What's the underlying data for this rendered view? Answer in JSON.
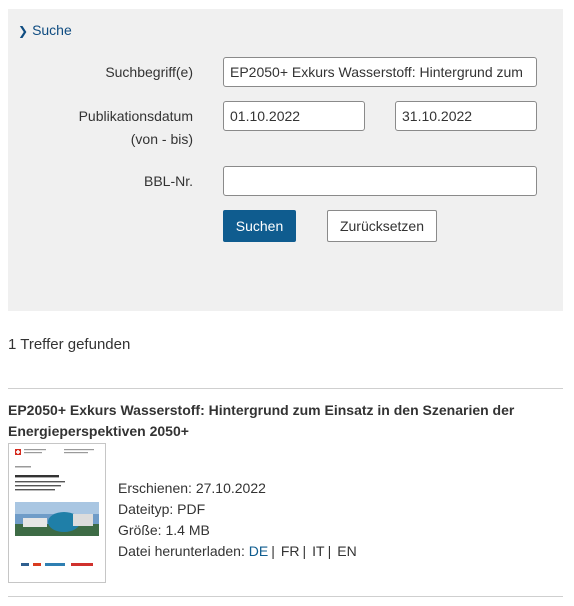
{
  "search": {
    "toggle_label": "Suche",
    "term_label": "Suchbegriff(e)",
    "term_value": "EP2050+ Exkurs Wasserstoff: Hintergrund zum",
    "date_label": "Publikationsdatum",
    "date_sublabel": "(von - bis)",
    "date_from": "01.10.2022",
    "date_to": "31.10.2022",
    "bbl_label": "BBL-Nr.",
    "bbl_value": "",
    "search_button": "Suchen",
    "reset_button": "Zurücksetzen"
  },
  "results": {
    "count_text": "1 Treffer gefunden",
    "items": [
      {
        "title": "EP2050+ Exkurs Wasserstoff: Hintergrund zum Einsatz in den Szenarien der Energieperspektiven 2050+",
        "published_label": "Erschienen:",
        "published": "27.10.2022",
        "filetype_label": "Dateityp:",
        "filetype": "PDF",
        "size_label": "Größe:",
        "size": "1.4 MB",
        "download_label": "Datei herunterladen:",
        "languages": [
          "DE",
          "FR",
          "IT",
          "EN"
        ],
        "active_language": "DE",
        "thumbnail": {
          "icon": "pdf-cover-thumbnail",
          "cover_title": "Energieperspektiven 2050+",
          "cover_subtitle": "Exkurs Wasserstoff: Hintergrund zum Einsatz in den Szenarien der Energieperspektiven 2050+",
          "logos": [
            "TEP",
            "ECOPLAN",
            "INFRAS"
          ]
        }
      }
    ]
  },
  "colors": {
    "panel_bg": "#f0f0f0",
    "primary_button": "#0f5c8f",
    "link": "#0f4c81",
    "divider": "#cfcfcf"
  }
}
